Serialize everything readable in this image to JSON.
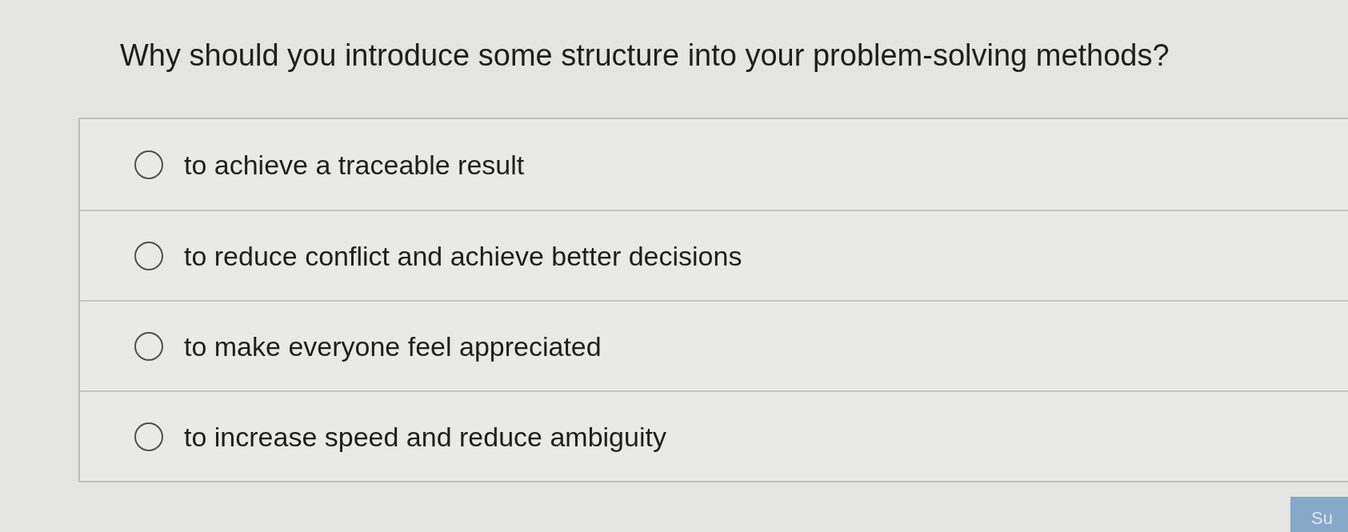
{
  "question": "Why should you introduce some structure into your problem-solving methods?",
  "options": [
    {
      "label": "to achieve a traceable result",
      "selected": false
    },
    {
      "label": "to reduce conflict and achieve better decisions",
      "selected": false
    },
    {
      "label": "to make everyone feel appreciated",
      "selected": false
    },
    {
      "label": "to increase speed and reduce ambiguity",
      "selected": false
    }
  ],
  "submit_button": {
    "label": "Su"
  }
}
